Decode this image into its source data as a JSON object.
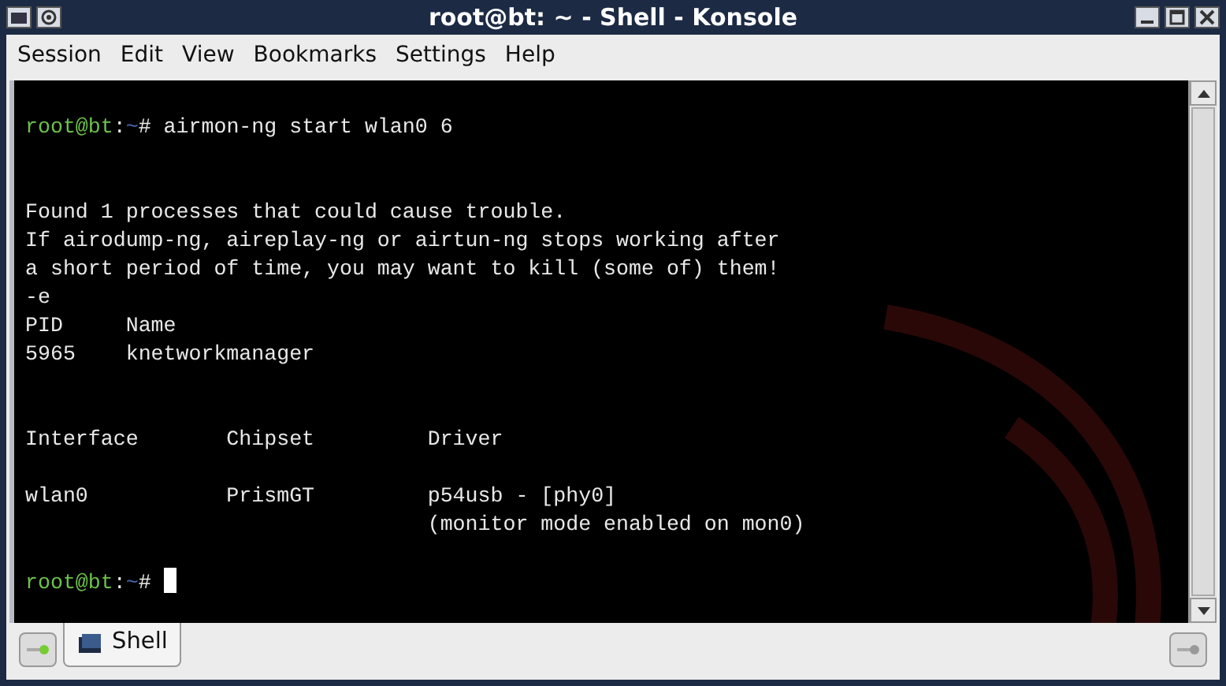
{
  "window": {
    "title": "root@bt: ~ - Shell - Konsole"
  },
  "menu": [
    "Session",
    "Edit",
    "View",
    "Bookmarks",
    "Settings",
    "Help"
  ],
  "terminal": {
    "lines": [
      {
        "kind": "blank"
      },
      {
        "kind": "prompt",
        "user": "root@bt",
        "sep": ":",
        "path": "~",
        "symbol": "#",
        "command": "airmon-ng start wlan0 6",
        "cursor": false
      },
      {
        "kind": "blank"
      },
      {
        "kind": "blank"
      },
      {
        "kind": "output",
        "text": "Found 1 processes that could cause trouble."
      },
      {
        "kind": "output",
        "text": "If airodump-ng, aireplay-ng or airtun-ng stops working after"
      },
      {
        "kind": "output",
        "text": "a short period of time, you may want to kill (some of) them!"
      },
      {
        "kind": "output",
        "text": "-e"
      },
      {
        "kind": "output",
        "text": "PID     Name"
      },
      {
        "kind": "output",
        "text": "5965    knetworkmanager"
      },
      {
        "kind": "blank"
      },
      {
        "kind": "blank"
      },
      {
        "kind": "output",
        "text": "Interface       Chipset         Driver"
      },
      {
        "kind": "blank"
      },
      {
        "kind": "output",
        "text": "wlan0           PrismGT         p54usb - [phy0]"
      },
      {
        "kind": "output",
        "text": "                                (monitor mode enabled on mon0)"
      },
      {
        "kind": "blank"
      },
      {
        "kind": "prompt",
        "user": "root@bt",
        "sep": ":",
        "path": "~",
        "symbol": "#",
        "cursor": true
      }
    ]
  },
  "tabs": [
    {
      "label": "Shell",
      "selected": true
    }
  ]
}
